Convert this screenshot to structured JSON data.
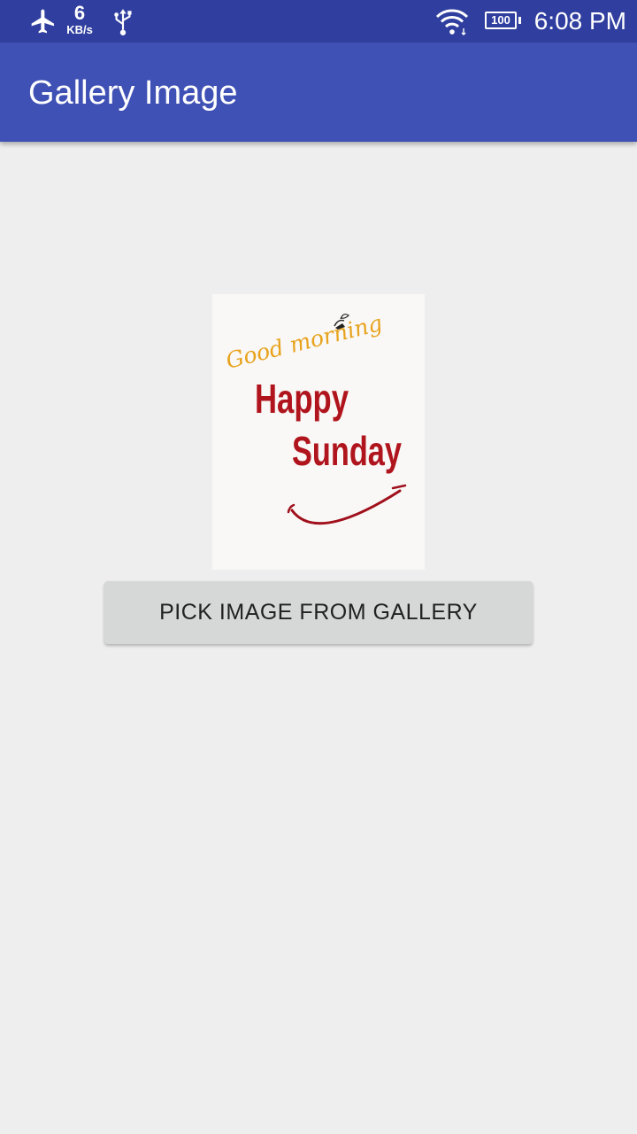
{
  "status_bar": {
    "network_speed_value": "6",
    "network_speed_unit": "KB/s",
    "battery_level": "100",
    "time": "6:08 PM",
    "icons": [
      "airplane-mode-icon",
      "usb-icon",
      "wifi-icon",
      "battery-icon"
    ],
    "background_color": "#303f9f"
  },
  "app_bar": {
    "title": "Gallery Image",
    "background_color": "#3f51b5"
  },
  "main": {
    "preview_image": {
      "line_1": "Good morning",
      "line_2": "Happy",
      "line_3": "Sunday",
      "script_color": "#e8a21c",
      "headline_color": "#b0151e"
    },
    "pick_button_label": "PICK IMAGE FROM GALLERY"
  }
}
